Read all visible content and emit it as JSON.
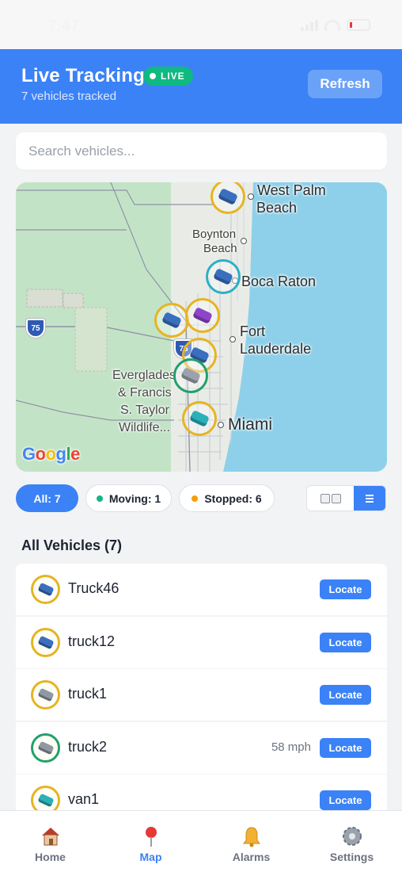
{
  "status_bar": {
    "time": "7:47"
  },
  "header": {
    "title": "Live Tracking",
    "live_badge": "LIVE",
    "subtitle": "7 vehicles tracked",
    "refresh_label": "Refresh"
  },
  "search": {
    "placeholder": "Search vehicles..."
  },
  "map": {
    "labels": {
      "west_palm": "West Palm",
      "west_palm_2": "Beach",
      "boynton": "Boynton",
      "boynton_2": "Beach",
      "boca": "Boca Raton",
      "fort": "Fort",
      "fort_2": "Lauderdale",
      "everglades_1": "Everglades",
      "everglades_2": "& Francis",
      "everglades_3": "S. Taylor",
      "everglades_4": "Wildlife...",
      "miami": "Miami",
      "i75_a": "75",
      "i75_b": "75"
    },
    "google": {
      "g1": "G",
      "o1": "o",
      "o2": "o",
      "g2": "g",
      "l": "l",
      "e": "e"
    }
  },
  "filters": {
    "all": "All: 7",
    "moving": "Moving: 1",
    "stopped": "Stopped: 6",
    "moving_color": "#10b981",
    "stopped_color": "#f59e0b"
  },
  "section": {
    "title": "All Vehicles (7)"
  },
  "vehicles": [
    {
      "name": "Truck46",
      "speed": "",
      "locate": "Locate",
      "icon": "truck-icon",
      "status": "stopped"
    },
    {
      "name": "truck12",
      "speed": "",
      "locate": "Locate",
      "icon": "truck-icon",
      "status": "stopped"
    },
    {
      "name": "truck1",
      "speed": "",
      "locate": "Locate",
      "icon": "truck-icon",
      "status": "stopped"
    },
    {
      "name": "truck2",
      "speed": "58 mph",
      "locate": "Locate",
      "icon": "truck-icon",
      "status": "moving"
    },
    {
      "name": "van1",
      "speed": "",
      "locate": "Locate",
      "icon": "van-icon",
      "status": "stopped"
    }
  ],
  "tabs": [
    {
      "label": "Home",
      "icon": "house-icon"
    },
    {
      "label": "Map",
      "icon": "map-pin-icon",
      "active": true
    },
    {
      "label": "Alarms",
      "icon": "bell-icon"
    },
    {
      "label": "Settings",
      "icon": "gear-icon"
    }
  ],
  "colors": {
    "primary": "#3b82f6",
    "live": "#10b981",
    "stopped_ring": "#e6b422",
    "moving_ring": "#22a06b"
  }
}
